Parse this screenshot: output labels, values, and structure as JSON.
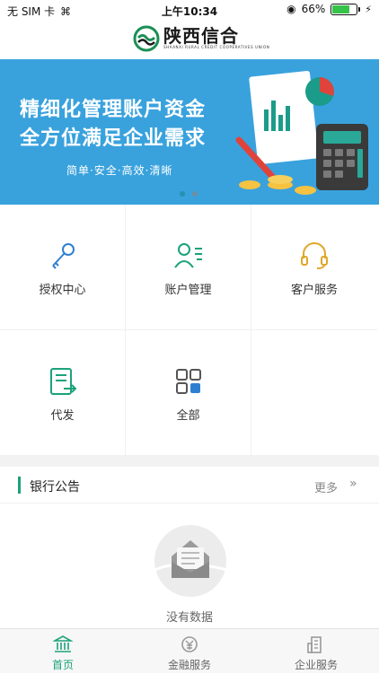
{
  "status_bar": {
    "carrier": "无 SIM 卡",
    "time": "上午10:34",
    "battery_percent": "66%",
    "battery_level": 0.66
  },
  "header": {
    "logo_text": "陕西信合",
    "logo_subtext": "SHAANXI RURAL CREDIT COOPERATIVES UNION"
  },
  "banner": {
    "line1": "精细化管理账户资金",
    "line2": "全方位满足企业需求",
    "subtitle": "简单·安全·高效·清晰",
    "page_count": 2,
    "active_page": 1
  },
  "services": [
    {
      "label": "授权中心",
      "icon": "key-icon"
    },
    {
      "label": "账户管理",
      "icon": "account-user-icon"
    },
    {
      "label": "客户服务",
      "icon": "headset-icon"
    },
    {
      "label": "代发",
      "icon": "document-send-icon"
    },
    {
      "label": "全部",
      "icon": "grid-all-icon"
    }
  ],
  "announcements": {
    "title": "银行公告",
    "more_label": "更多",
    "empty_text": "没有数据"
  },
  "tabbar": {
    "tabs": [
      {
        "label": "首页",
        "icon": "bank-icon",
        "active": true
      },
      {
        "label": "金融服务",
        "icon": "finance-service-icon",
        "active": false
      },
      {
        "label": "企业服务",
        "icon": "building-icon",
        "active": false
      }
    ]
  },
  "colors": {
    "accent": "#1ba27a",
    "banner_bg": "#39a2dd",
    "icon_blue": "#2f7fd1",
    "icon_gold": "#e0a72a"
  }
}
